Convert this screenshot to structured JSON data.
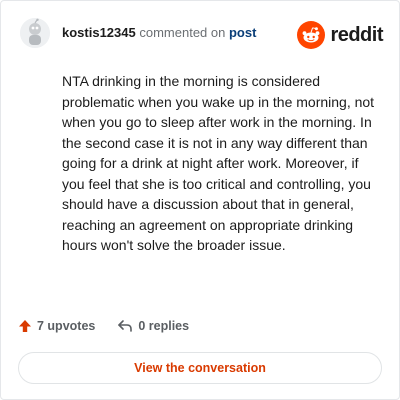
{
  "comment": {
    "username": "kostis12345",
    "action_text": "commented on",
    "post_link_label": "post",
    "avatar_icon": "snoo-avatar-icon",
    "body": "NTA drinking in the morning is considered problematic when you wake up in the morning, not when you go to sleep after work in the morning. In the second case it is not in any way different than going for a drink at night after work. Moreover, if you feel that she is too critical and controlling, you should have a discussion about that in general, reaching an agreement on appropriate drinking hours won't solve the broader issue."
  },
  "brand": {
    "name": "reddit",
    "icon": "reddit-logo-icon",
    "accent_color": "#ff4500"
  },
  "stats": {
    "upvotes_label": "7 upvotes",
    "replies_label": "0 replies",
    "upvote_icon": "upvote-arrow-icon",
    "reply_icon": "reply-arrow-icon",
    "upvote_color": "#d93a00"
  },
  "cta": {
    "label": "View the conversation",
    "color": "#d93a00"
  }
}
